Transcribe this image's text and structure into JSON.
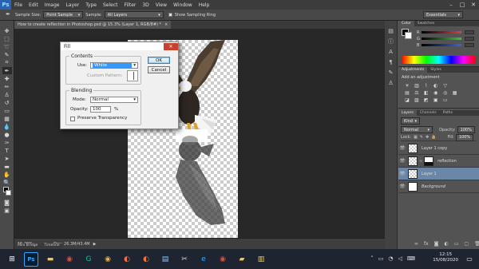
{
  "app": {
    "logo": "Ps"
  },
  "menu": [
    "File",
    "Edit",
    "Image",
    "Layer",
    "Type",
    "Select",
    "Filter",
    "3D",
    "View",
    "Window",
    "Help"
  ],
  "window_controls": {
    "minimize": "–",
    "maximize": "□",
    "close": "✕"
  },
  "options_bar": {
    "sample_size_label": "Sample Size:",
    "sample_size_value": "Point Sample",
    "sample_label": "Sample:",
    "sample_value": "All Layers",
    "show_sampling_ring": "Show Sampling Ring",
    "workspace": "Essentials"
  },
  "document_tab": {
    "title": "How to create reflection in Photoshop.psd @ 15.3% (Layer 1, RGB/8#) *",
    "close": "×"
  },
  "status_bar": {
    "zoom": "15.29%",
    "doc_size": "Doc: 26.3M/43.4M"
  },
  "bottom_tabs": [
    "Mini Bridge",
    "Timeline"
  ],
  "fill_dialog": {
    "title": "Fill",
    "close": "✕",
    "contents_legend": "Contents",
    "use_label": "Use:",
    "use_value": "White",
    "custom_pattern_label": "Custom Pattern:",
    "blending_legend": "Blending",
    "mode_label": "Mode:",
    "mode_value": "Normal",
    "opacity_label": "Opacity:",
    "opacity_value": "100",
    "opacity_unit": "%",
    "preserve_transparency": "Preserve Transparency",
    "ok_label": "OK",
    "cancel_label": "Cancel"
  },
  "color_panel": {
    "tabs": [
      "Color",
      "Swatches"
    ],
    "sliders": [
      "R",
      "G",
      "B"
    ],
    "slider_colors": [
      "#e04040",
      "#40c040",
      "#4060e0"
    ]
  },
  "adjustments_panel": {
    "tabs": [
      "Adjustments",
      "Styles"
    ],
    "heading": "Add an adjustment"
  },
  "layers_panel": {
    "tabs": [
      "Layers",
      "Channels",
      "Paths"
    ],
    "kind_label": "Kind",
    "blend_mode": "Normal",
    "opacity_label": "Opacity:",
    "opacity_value": "100%",
    "lock_label": "Lock:",
    "fill_label": "Fill:",
    "fill_value": "100%",
    "layers": [
      {
        "name": "Layer 1 copy",
        "selected": false
      },
      {
        "name": "reflection",
        "selected": false
      },
      {
        "name": "Layer 1",
        "selected": true
      },
      {
        "name": "Background",
        "selected": false
      }
    ]
  },
  "taskbar": {
    "icons": [
      "windows-icon",
      "photoshop-icon",
      "file-explorer-icon",
      "chrome-icon",
      "grammarly-icon",
      "chrome-icon",
      "firefox-icon",
      "firefox-icon",
      "notepad-icon",
      "word-icon",
      "capture-icon",
      "edge-icon",
      "chrome-icon",
      "folder-icon",
      "notes-icon"
    ],
    "time": "12:15",
    "date": "15/08/2020"
  }
}
